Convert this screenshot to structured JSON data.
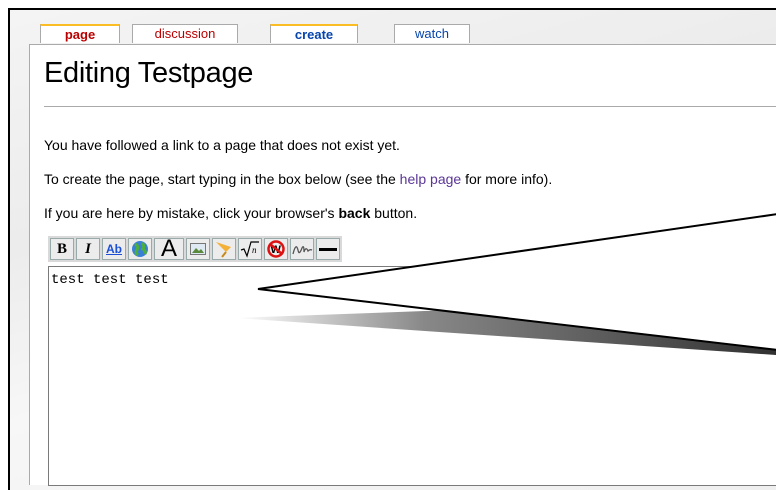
{
  "tabs": [
    {
      "label": "page"
    },
    {
      "label": "discussion"
    },
    {
      "label": "create"
    },
    {
      "label": "watch"
    }
  ],
  "page_title": "Editing Testpage",
  "intro": {
    "line1": "You have followed a link to a page that does not exist yet.",
    "line2_pre": "To create the page, start typing in the box below (see the ",
    "line2_link": "help page",
    "line2_post": " for more info).",
    "line3_pre": "If you are here by mistake, click your browser's ",
    "line3_bold": "back",
    "line3_post": " button."
  },
  "toolbar": {
    "bold_label": "B",
    "italic_label": "I",
    "link_label": "Ab",
    "headline_label": "A",
    "items": [
      "bold-icon",
      "italic-icon",
      "internal-link-icon",
      "external-link-icon",
      "headline-icon",
      "image-icon",
      "media-icon",
      "math-icon",
      "nowiki-icon",
      "signature-icon",
      "horizontal-line-icon"
    ]
  },
  "editor": {
    "value": "test test test"
  },
  "colors": {
    "selected_tab_accent": "#fabd23",
    "red_link": "#ba0000",
    "blue_link": "#0645ad",
    "visited_link": "#5a3696"
  }
}
